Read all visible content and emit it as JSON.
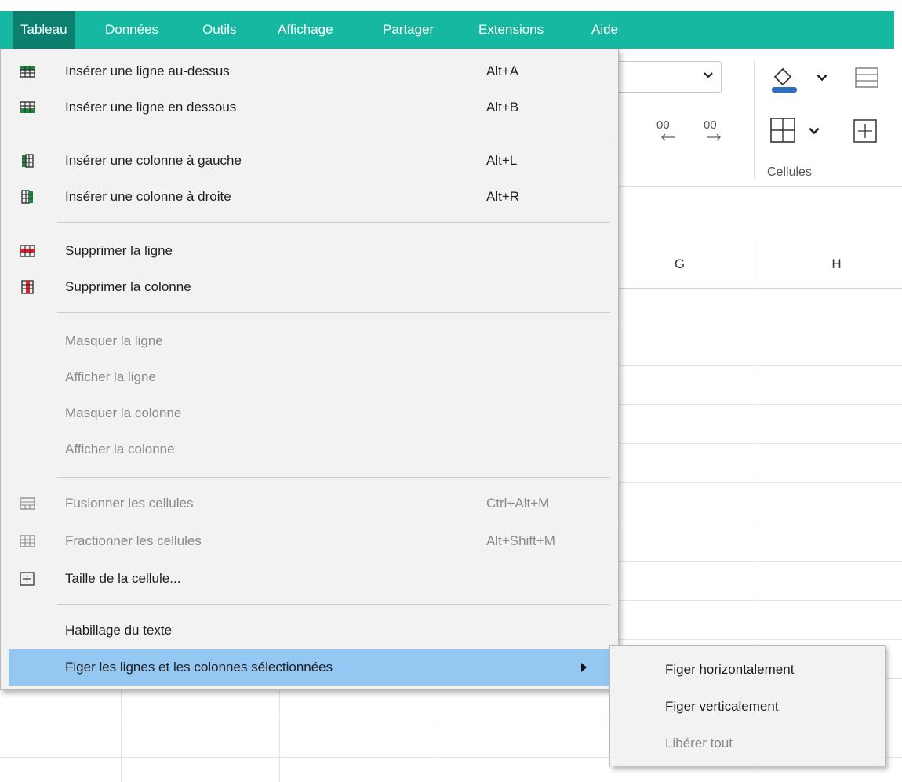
{
  "menubar": {
    "items": [
      "Tableau",
      "Données",
      "Outils",
      "Affichage",
      "Partager",
      "Extensions",
      "Aide"
    ],
    "accent_color": "#17b8a1",
    "active_color": "#0d7f6f"
  },
  "ribbon": {
    "cells_group_label": "Cellules"
  },
  "sheet": {
    "columns": [
      "G",
      "H"
    ]
  },
  "menu": {
    "items": [
      {
        "label": "Insérer une ligne au-dessus",
        "shortcut": "Alt+A",
        "icon": "insert-row-above-icon",
        "disabled": false
      },
      {
        "label": "Insérer une ligne en dessous",
        "shortcut": "Alt+B",
        "icon": "insert-row-below-icon",
        "disabled": false
      },
      {
        "label": "Insérer une colonne à gauche",
        "shortcut": "Alt+L",
        "icon": "insert-column-left-icon",
        "disabled": false
      },
      {
        "label": "Insérer une colonne à droite",
        "shortcut": "Alt+R",
        "icon": "insert-column-right-icon",
        "disabled": false
      },
      {
        "label": "Supprimer la ligne",
        "shortcut": "",
        "icon": "delete-row-icon",
        "disabled": false
      },
      {
        "label": "Supprimer la colonne",
        "shortcut": "",
        "icon": "delete-column-icon",
        "disabled": false
      },
      {
        "label": "Masquer la ligne",
        "shortcut": "",
        "icon": "",
        "disabled": true
      },
      {
        "label": "Afficher la ligne",
        "shortcut": "",
        "icon": "",
        "disabled": true
      },
      {
        "label": "Masquer la colonne",
        "shortcut": "",
        "icon": "",
        "disabled": true
      },
      {
        "label": "Afficher la colonne",
        "shortcut": "",
        "icon": "",
        "disabled": true
      },
      {
        "label": "Fusionner les cellules",
        "shortcut": "Ctrl+Alt+M",
        "icon": "merge-cells-icon",
        "disabled": true
      },
      {
        "label": "Fractionner les cellules",
        "shortcut": "Alt+Shift+M",
        "icon": "split-cells-icon",
        "disabled": true
      },
      {
        "label": "Taille de la cellule...",
        "shortcut": "",
        "icon": "cell-size-icon",
        "disabled": false
      },
      {
        "label": "Habillage du texte",
        "shortcut": "",
        "icon": "",
        "disabled": false
      },
      {
        "label": "Figer les lignes et les colonnes sélectionnées",
        "shortcut": "",
        "icon": "",
        "disabled": false,
        "highlighted": true,
        "has_submenu": true
      }
    ],
    "highlight_color": "#94c7f2"
  },
  "submenu": {
    "items": [
      {
        "label": "Figer horizontalement",
        "disabled": false
      },
      {
        "label": "Figer verticalement",
        "disabled": false
      },
      {
        "label": "Libérer tout",
        "disabled": true
      }
    ]
  }
}
